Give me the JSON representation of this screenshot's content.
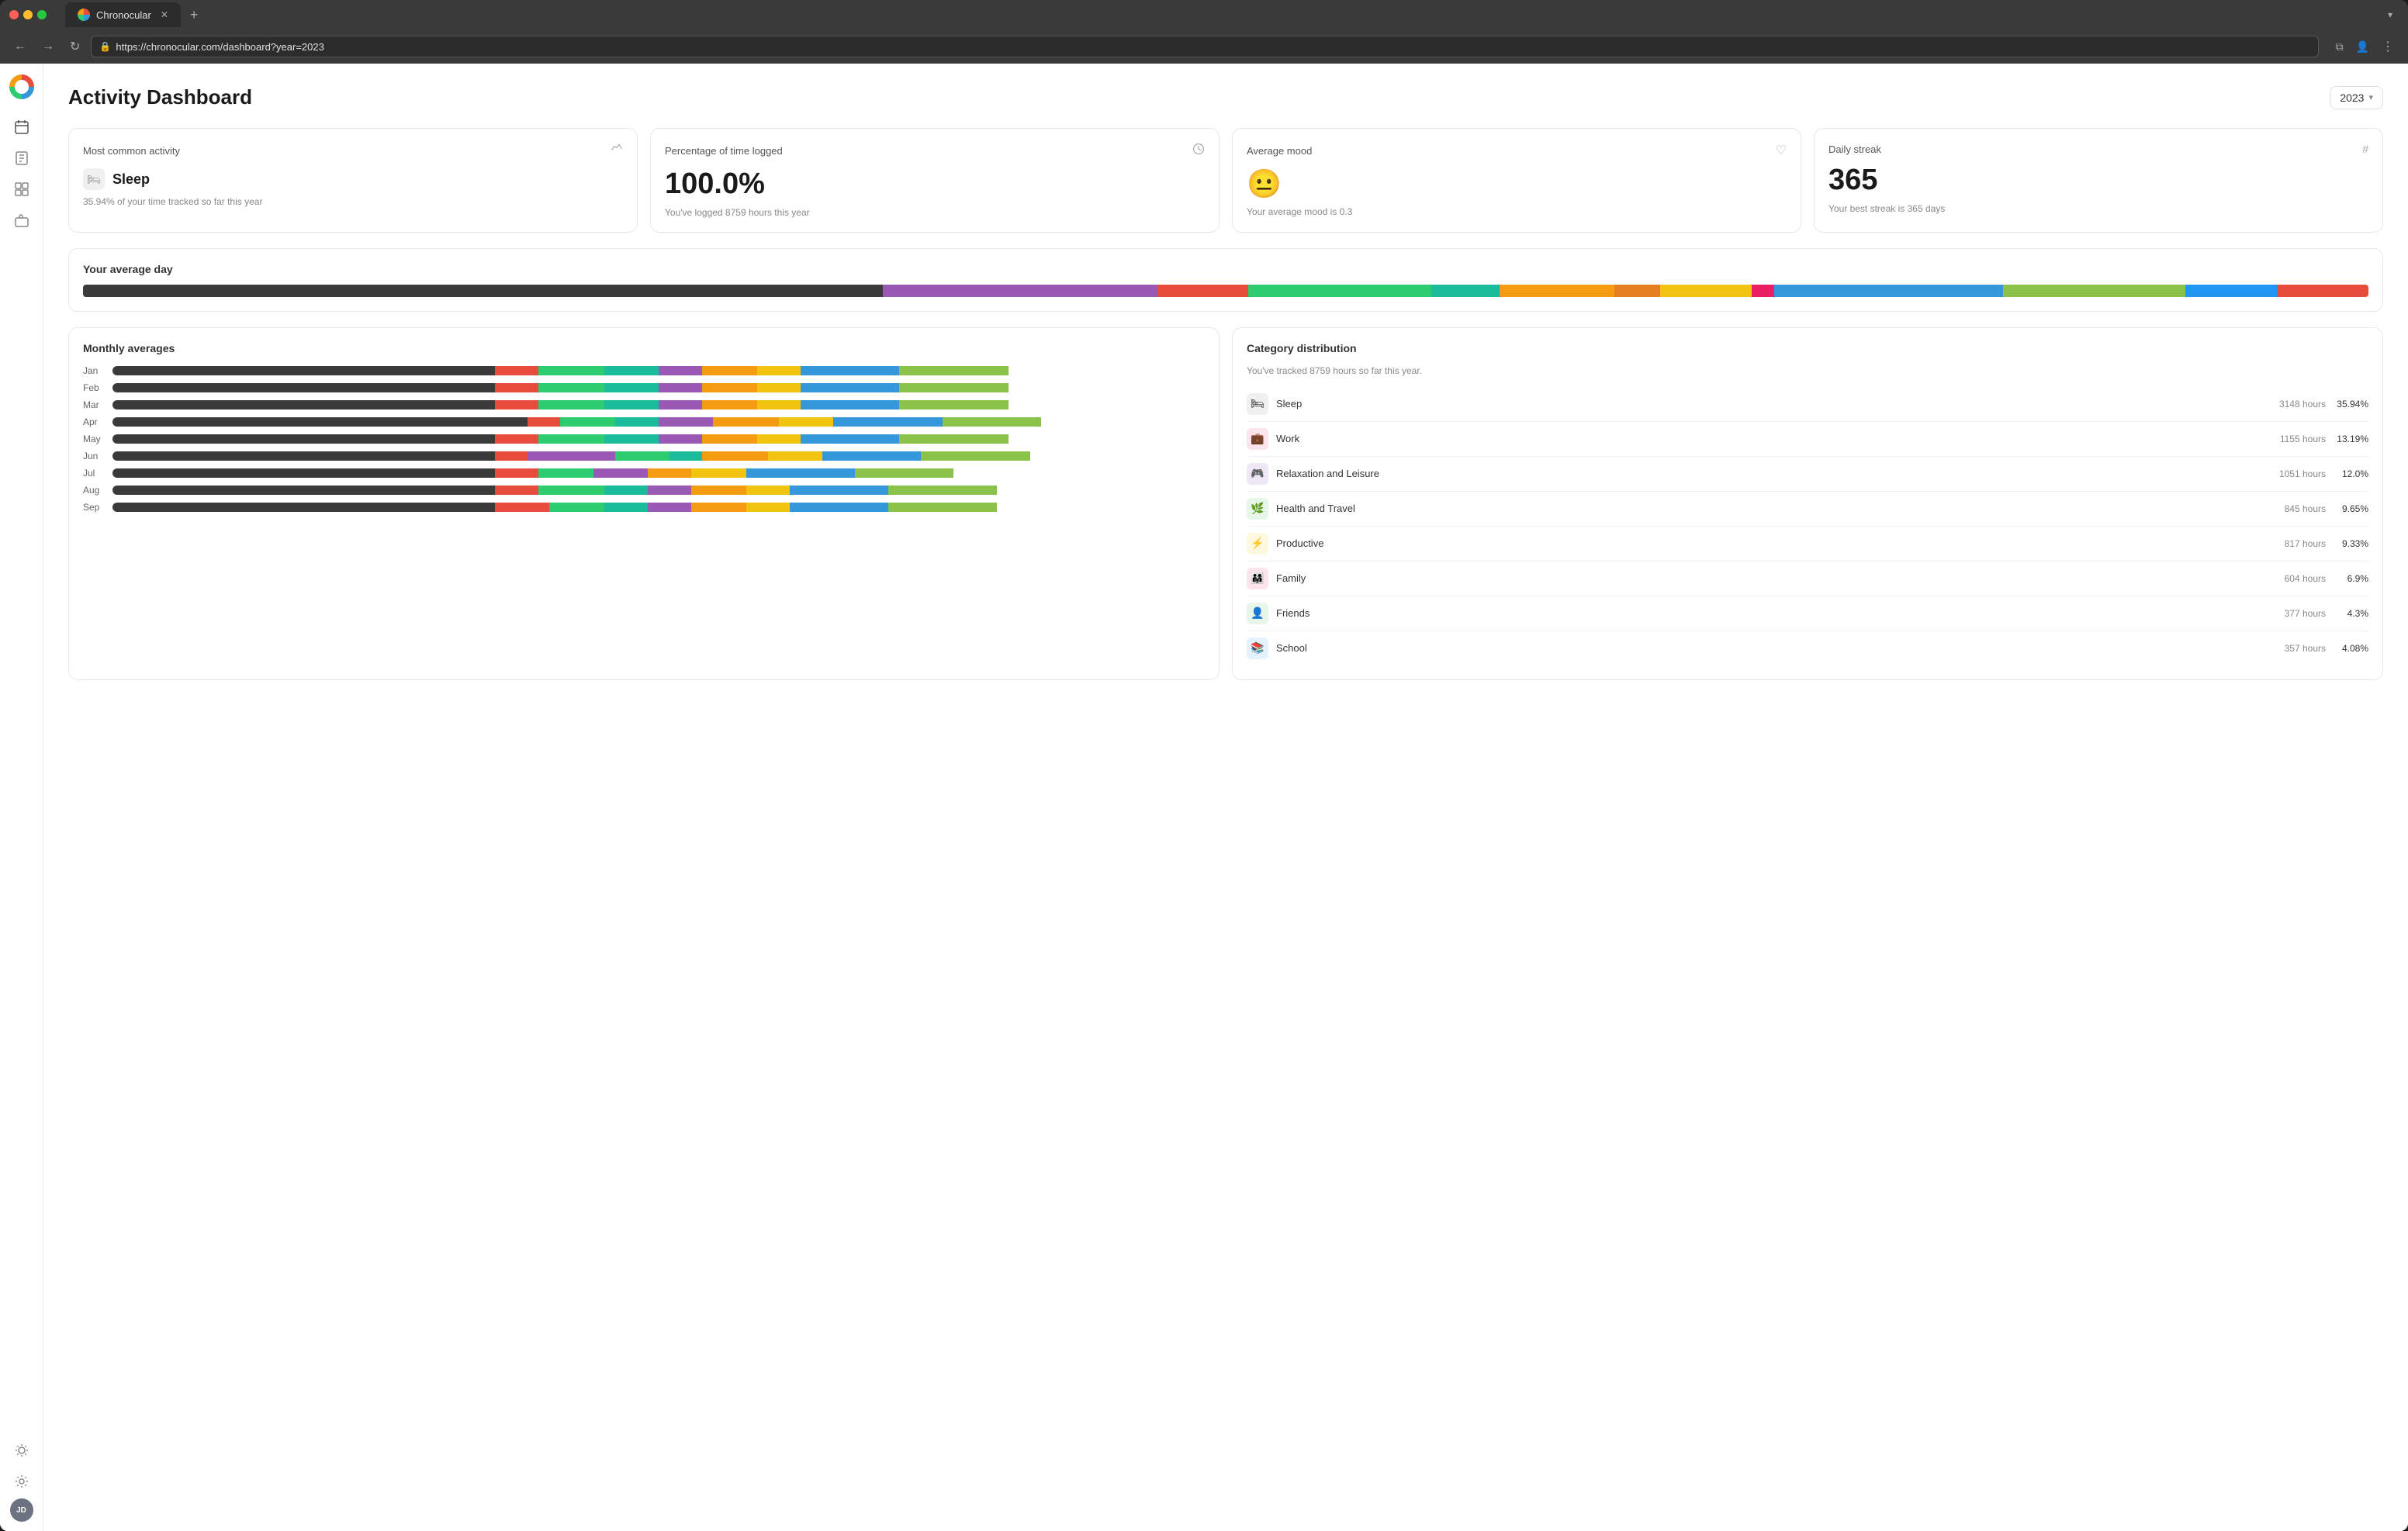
{
  "browser": {
    "traffic_lights": [
      "red",
      "yellow",
      "green"
    ],
    "tab_title": "Chronocular",
    "tab_close": "✕",
    "tab_new": "+",
    "tab_dropdown": "▾",
    "url": "https://chronocular.com/dashboard?year=2023",
    "nav_back": "←",
    "nav_forward": "→",
    "nav_refresh": "↻"
  },
  "sidebar": {
    "logo_text": "C",
    "items": [
      {
        "name": "calendar",
        "icon": "▦"
      },
      {
        "name": "journal",
        "icon": "◫"
      },
      {
        "name": "grid",
        "icon": "⊞"
      },
      {
        "name": "briefcase",
        "icon": "◻"
      }
    ],
    "bottom": [
      {
        "name": "sun",
        "icon": "✦"
      },
      {
        "name": "settings",
        "icon": "◉"
      }
    ],
    "avatar": "JD"
  },
  "dashboard": {
    "title": "Activity Dashboard",
    "year_selector": "2023",
    "year_selector_arrow": "▾"
  },
  "stats": {
    "cards": [
      {
        "title": "Most common activity",
        "icon": "⚡",
        "activity_icon": "🛏",
        "activity_name": "Sleep",
        "subtitle": "35.94% of your time tracked so far this year"
      },
      {
        "title": "Percentage of time logged",
        "icon": "⏱",
        "value": "100.0%",
        "subtitle": "You've logged 8759 hours this year"
      },
      {
        "title": "Average mood",
        "icon": "♡",
        "emoji": "😐",
        "subtitle": "Your average mood is 0.3"
      },
      {
        "title": "Daily streak",
        "icon": "#",
        "value": "365",
        "subtitle": "Your best streak is 365 days"
      }
    ]
  },
  "avg_day": {
    "title": "Your average day",
    "segments": [
      {
        "color": "#3a3a3a",
        "pct": 35
      },
      {
        "color": "#9b59b6",
        "pct": 12
      },
      {
        "color": "#e74c3c",
        "pct": 4
      },
      {
        "color": "#2ecc71",
        "pct": 8
      },
      {
        "color": "#1abc9c",
        "pct": 3
      },
      {
        "color": "#f39c12",
        "pct": 5
      },
      {
        "color": "#e67e22",
        "pct": 2
      },
      {
        "color": "#f1c40f",
        "pct": 4
      },
      {
        "color": "#e91e63",
        "pct": 1
      },
      {
        "color": "#3498db",
        "pct": 10
      },
      {
        "color": "#8bc34a",
        "pct": 8
      },
      {
        "color": "#2196f3",
        "pct": 4
      },
      {
        "color": "#e74c3c",
        "pct": 4
      }
    ]
  },
  "monthly": {
    "title": "Monthly averages",
    "months": [
      {
        "label": "Jan",
        "segments": [
          {
            "color": "#3a3a3a",
            "pct": 35
          },
          {
            "color": "#e74c3c",
            "pct": 4
          },
          {
            "color": "#2ecc71",
            "pct": 6
          },
          {
            "color": "#1abc9c",
            "pct": 5
          },
          {
            "color": "#9b59b6",
            "pct": 4
          },
          {
            "color": "#f39c12",
            "pct": 5
          },
          {
            "color": "#f1c40f",
            "pct": 4
          },
          {
            "color": "#3498db",
            "pct": 9
          },
          {
            "color": "#8bc34a",
            "pct": 10
          }
        ]
      },
      {
        "label": "Feb",
        "segments": [
          {
            "color": "#3a3a3a",
            "pct": 35
          },
          {
            "color": "#e74c3c",
            "pct": 4
          },
          {
            "color": "#2ecc71",
            "pct": 6
          },
          {
            "color": "#1abc9c",
            "pct": 5
          },
          {
            "color": "#9b59b6",
            "pct": 4
          },
          {
            "color": "#f39c12",
            "pct": 5
          },
          {
            "color": "#f1c40f",
            "pct": 4
          },
          {
            "color": "#3498db",
            "pct": 9
          },
          {
            "color": "#8bc34a",
            "pct": 10
          }
        ]
      },
      {
        "label": "Mar",
        "segments": [
          {
            "color": "#3a3a3a",
            "pct": 35
          },
          {
            "color": "#e74c3c",
            "pct": 4
          },
          {
            "color": "#2ecc71",
            "pct": 6
          },
          {
            "color": "#1abc9c",
            "pct": 5
          },
          {
            "color": "#9b59b6",
            "pct": 4
          },
          {
            "color": "#f39c12",
            "pct": 5
          },
          {
            "color": "#f1c40f",
            "pct": 4
          },
          {
            "color": "#3498db",
            "pct": 9
          },
          {
            "color": "#8bc34a",
            "pct": 10
          }
        ]
      },
      {
        "label": "Apr",
        "segments": [
          {
            "color": "#3a3a3a",
            "pct": 38
          },
          {
            "color": "#e74c3c",
            "pct": 3
          },
          {
            "color": "#2ecc71",
            "pct": 5
          },
          {
            "color": "#1abc9c",
            "pct": 4
          },
          {
            "color": "#9b59b6",
            "pct": 5
          },
          {
            "color": "#f39c12",
            "pct": 6
          },
          {
            "color": "#f1c40f",
            "pct": 5
          },
          {
            "color": "#3498db",
            "pct": 10
          },
          {
            "color": "#8bc34a",
            "pct": 9
          }
        ]
      },
      {
        "label": "May",
        "segments": [
          {
            "color": "#3a3a3a",
            "pct": 35
          },
          {
            "color": "#e74c3c",
            "pct": 4
          },
          {
            "color": "#2ecc71",
            "pct": 6
          },
          {
            "color": "#1abc9c",
            "pct": 5
          },
          {
            "color": "#9b59b6",
            "pct": 4
          },
          {
            "color": "#f39c12",
            "pct": 5
          },
          {
            "color": "#f1c40f",
            "pct": 4
          },
          {
            "color": "#3498db",
            "pct": 9
          },
          {
            "color": "#8bc34a",
            "pct": 10
          }
        ]
      },
      {
        "label": "Jun",
        "segments": [
          {
            "color": "#3a3a3a",
            "pct": 35
          },
          {
            "color": "#e74c3c",
            "pct": 3
          },
          {
            "color": "#9b59b6",
            "pct": 8
          },
          {
            "color": "#2ecc71",
            "pct": 5
          },
          {
            "color": "#1abc9c",
            "pct": 3
          },
          {
            "color": "#f39c12",
            "pct": 6
          },
          {
            "color": "#f1c40f",
            "pct": 5
          },
          {
            "color": "#3498db",
            "pct": 9
          },
          {
            "color": "#8bc34a",
            "pct": 10
          }
        ]
      },
      {
        "label": "Jul",
        "segments": [
          {
            "color": "#3a3a3a",
            "pct": 35
          },
          {
            "color": "#e74c3c",
            "pct": 4
          },
          {
            "color": "#2ecc71",
            "pct": 5
          },
          {
            "color": "#9b59b6",
            "pct": 5
          },
          {
            "color": "#f39c12",
            "pct": 4
          },
          {
            "color": "#f1c40f",
            "pct": 5
          },
          {
            "color": "#3498db",
            "pct": 10
          },
          {
            "color": "#8bc34a",
            "pct": 9
          }
        ]
      },
      {
        "label": "Aug",
        "segments": [
          {
            "color": "#3a3a3a",
            "pct": 35
          },
          {
            "color": "#e74c3c",
            "pct": 4
          },
          {
            "color": "#2ecc71",
            "pct": 6
          },
          {
            "color": "#1abc9c",
            "pct": 4
          },
          {
            "color": "#9b59b6",
            "pct": 4
          },
          {
            "color": "#f39c12",
            "pct": 5
          },
          {
            "color": "#f1c40f",
            "pct": 4
          },
          {
            "color": "#3498db",
            "pct": 9
          },
          {
            "color": "#8bc34a",
            "pct": 10
          }
        ]
      },
      {
        "label": "Sep",
        "segments": [
          {
            "color": "#3a3a3a",
            "pct": 35
          },
          {
            "color": "#e74c3c",
            "pct": 5
          },
          {
            "color": "#2ecc71",
            "pct": 5
          },
          {
            "color": "#1abc9c",
            "pct": 4
          },
          {
            "color": "#9b59b6",
            "pct": 4
          },
          {
            "color": "#f39c12",
            "pct": 5
          },
          {
            "color": "#f1c40f",
            "pct": 4
          },
          {
            "color": "#3498db",
            "pct": 9
          },
          {
            "color": "#8bc34a",
            "pct": 10
          }
        ]
      }
    ]
  },
  "categories": {
    "title": "Category distribution",
    "subtitle": "You've tracked 8759 hours so far this year.",
    "items": [
      {
        "icon": "🛏",
        "bg": "#f0f0f0",
        "name": "Sleep",
        "hours": "3148 hours",
        "pct": "35.94%"
      },
      {
        "icon": "💼",
        "bg": "#fce4ec",
        "name": "Work",
        "hours": "1155 hours",
        "pct": "13.19%"
      },
      {
        "icon": "🎮",
        "bg": "#ede7f6",
        "name": "Relaxation and Leisure",
        "hours": "1051 hours",
        "pct": "12.0%"
      },
      {
        "icon": "🌿",
        "bg": "#e8f5e9",
        "name": "Health and Travel",
        "hours": "845 hours",
        "pct": "9.65%"
      },
      {
        "icon": "⚡",
        "bg": "#fff8e1",
        "name": "Productive",
        "hours": "817 hours",
        "pct": "9.33%"
      },
      {
        "icon": "👨‍👩‍👧",
        "bg": "#fce4ec",
        "name": "Family",
        "hours": "604 hours",
        "pct": "6.9%"
      },
      {
        "icon": "👤",
        "bg": "#e8f5e9",
        "name": "Friends",
        "hours": "377 hours",
        "pct": "4.3%"
      },
      {
        "icon": "📚",
        "bg": "#e3f2fd",
        "name": "School",
        "hours": "357 hours",
        "pct": "4.08%"
      }
    ]
  }
}
